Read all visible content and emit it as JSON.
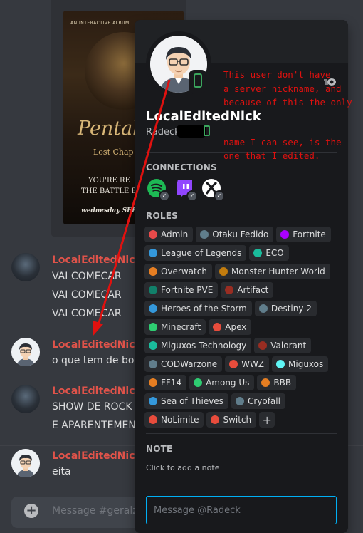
{
  "embed": {
    "poster": {
      "top_text": "AN INTERACTIVE ALBUM",
      "title": "Pentak",
      "subtitle": "Lost Chap",
      "line1": "YOU'RE RE",
      "line2": "THE BATTLE BE",
      "line3": "wednesday SEPT"
    }
  },
  "messages": [
    {
      "author": "LocalEditedNick",
      "lines": [
        "VAI COMECAR",
        "VAI COMECAR",
        "VAI COMECAR"
      ]
    },
    {
      "author": "LocalEditedNick",
      "lines": [
        "o que tem de bom"
      ]
    },
    {
      "author": "LocalEditedNick",
      "lines": [
        "SHOW DE ROCK",
        "E APARENTEMEN"
      ]
    },
    {
      "author": "LocalEditedNick",
      "lines": [
        "eita"
      ]
    }
  ],
  "composer": {
    "placeholder": "Message #geralz"
  },
  "profile": {
    "display_name": "LocalEditedNick",
    "username": "Radeck",
    "connections_title": "CONNECTIONS",
    "connections": [
      {
        "icon": "spotify-icon",
        "color": "#1db954"
      },
      {
        "icon": "twitch-icon",
        "color": "#9146ff"
      },
      {
        "icon": "xbox-icon",
        "color": "#ffffff"
      }
    ],
    "roles_title": "ROLES",
    "roles": [
      {
        "name": "Admin",
        "color": "#e84a4a"
      },
      {
        "name": "Otaku Fedido",
        "color": "#607d8b"
      },
      {
        "name": "Fortnite",
        "color": "#aa00ff"
      },
      {
        "name": "League of Legends",
        "color": "#3498db"
      },
      {
        "name": "ECO",
        "color": "#1abc9c"
      },
      {
        "name": "Overwatch",
        "color": "#e67e22"
      },
      {
        "name": "Monster Hunter World",
        "color": "#c27c0e"
      },
      {
        "name": "Fortnite PVE",
        "color": "#11806a"
      },
      {
        "name": "Artifact",
        "color": "#992d22"
      },
      {
        "name": "Heroes of the Storm",
        "color": "#3498db"
      },
      {
        "name": "Destiny 2",
        "color": "#607d8b"
      },
      {
        "name": "Minecraft",
        "color": "#2ecc71"
      },
      {
        "name": "Apex",
        "color": "#e74c3c"
      },
      {
        "name": "Miguxos Technology",
        "color": "#1abc9c"
      },
      {
        "name": "Valorant",
        "color": "#992d22"
      },
      {
        "name": "CODWarzone",
        "color": "#607d8b"
      },
      {
        "name": "WWZ",
        "color": "#e74c3c"
      },
      {
        "name": "Miguxos",
        "color": "#5ff5f5"
      },
      {
        "name": "FF14",
        "color": "#e67e22"
      },
      {
        "name": "Among Us",
        "color": "#2ecc71"
      },
      {
        "name": "BBB",
        "color": "#e67e22"
      },
      {
        "name": "Sea of Thieves",
        "color": "#3498db"
      },
      {
        "name": "Cryofall",
        "color": "#607d8b"
      },
      {
        "name": "NoLimite",
        "color": "#e74c3c"
      },
      {
        "name": "Switch",
        "color": "#e74c3c"
      }
    ],
    "add_role_label": "+",
    "note_title": "NOTE",
    "note_placeholder": "Click to add a note",
    "dm_placeholder": "Message @Radeck"
  },
  "annotation": {
    "lines": [
      "This user don't have",
      "a server nickname, and",
      "because of this the only",
      "name I can see, is the",
      "one that I edited."
    ],
    "color": "#e0110f"
  }
}
